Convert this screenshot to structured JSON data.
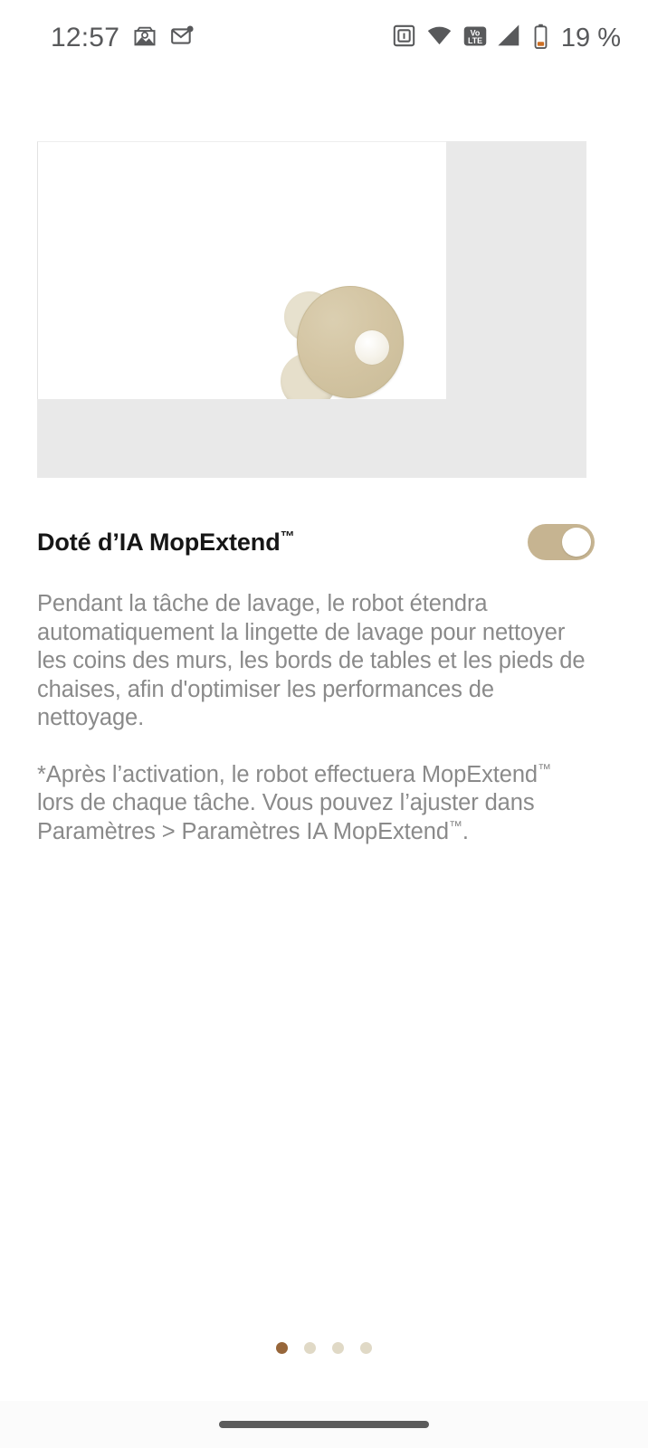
{
  "status_bar": {
    "clock": "12:57",
    "battery_percent": "19 %",
    "left_icons": [
      "screenshot-icon",
      "mail-unread-icon"
    ],
    "right_icons": [
      "nfc-icon",
      "wifi-icon",
      "volte-icon",
      "cellular-signal-icon",
      "battery-low-icon"
    ],
    "volte_top": "Vo",
    "volte_bottom": "LTE",
    "text_color": "#58595b",
    "battery_accent": "#cc6f24"
  },
  "media": {
    "alt": "robot-vacuum-mop-extend-animation",
    "frame_bg": "#e9e9e9",
    "video_bg": "#ffffff",
    "robot_body_color": "#d3c4a2",
    "robot_pad_color": "#e6dfcb",
    "robot_sensor_color": "#f5f2e9"
  },
  "feature": {
    "title": "Doté d’IA MopExtend",
    "title_trademark": "™",
    "toggle": {
      "state": "on",
      "track_color": "#c6b491",
      "knob_color": "#ffffff"
    }
  },
  "description": {
    "paragraph_1": "Pendant la tâche de lavage, le robot étendra automatiquement la lingette de lavage pour nettoyer les coins des murs, les bords de tables et les pieds de chaises, afin d'optimiser les performances de nettoyage.",
    "paragraph_2_before": "*Après l’activation, le robot effectuera MopExtend",
    "paragraph_2_tm_1": "™",
    "paragraph_2_middle": " lors de chaque tâche. Vous pouvez l’ajuster dans Paramètres > Paramètres IA MopExtend",
    "paragraph_2_tm_2": "™",
    "paragraph_2_after": ".",
    "text_color": "#8a8a8a"
  },
  "pagination": {
    "total": 4,
    "active_index": 0,
    "active_color": "#97663a",
    "inactive_color": "#e0d9c6"
  },
  "nav_bar": {
    "gesture_pill_color": "#5c5c5c"
  }
}
